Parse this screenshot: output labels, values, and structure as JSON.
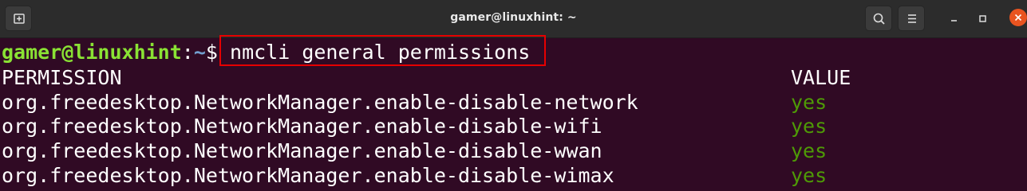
{
  "window": {
    "title": "gamer@linuxhint: ~"
  },
  "terminal": {
    "prompt": {
      "user_host": "gamer@linuxhint",
      "separator": ":",
      "path": "~",
      "symbol": "$ "
    },
    "command": "nmcli general permissions",
    "headers": {
      "permission": "PERMISSION",
      "value": "VALUE"
    },
    "rows": [
      {
        "permission": "org.freedesktop.NetworkManager.enable-disable-network",
        "value": "yes"
      },
      {
        "permission": "org.freedesktop.NetworkManager.enable-disable-wifi",
        "value": "yes"
      },
      {
        "permission": "org.freedesktop.NetworkManager.enable-disable-wwan",
        "value": "yes"
      },
      {
        "permission": "org.freedesktop.NetworkManager.enable-disable-wimax",
        "value": "yes"
      }
    ]
  },
  "colors": {
    "terminal_bg": "#300a24",
    "prompt_user": "#8ae234",
    "prompt_path": "#729fcf",
    "value_yes": "#4e9a06",
    "highlight_border": "#e60000",
    "close_button": "#e95420"
  },
  "icons": {
    "new_tab": "new-tab-icon",
    "search": "search-icon",
    "menu": "hamburger-menu-icon",
    "minimize": "minimize-icon",
    "maximize": "maximize-icon",
    "close": "close-icon"
  }
}
